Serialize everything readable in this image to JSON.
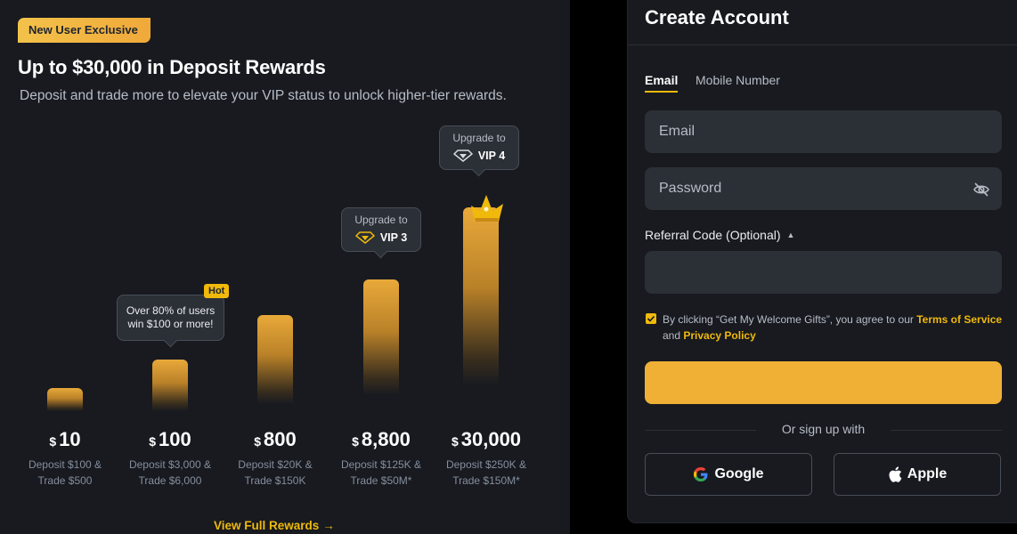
{
  "promo": {
    "badge": "New User Exclusive",
    "title": "Up to $30,000 in Deposit Rewards",
    "subtitle": "Deposit and trade more to elevate your VIP status to unlock higher-tier rewards.",
    "currency_symbol": "$",
    "tiers": [
      {
        "amount": "10",
        "desc_line1": "Deposit $100 &",
        "desc_line2": "Trade $500"
      },
      {
        "amount": "100",
        "desc_line1": "Deposit $3,000 &",
        "desc_line2": "Trade $6,000"
      },
      {
        "amount": "800",
        "desc_line1": "Deposit $20K &",
        "desc_line2": "Trade $150K"
      },
      {
        "amount": "8,800",
        "desc_line1": "Deposit $125K &",
        "desc_line2": "Trade $50M*"
      },
      {
        "amount": "30,000",
        "desc_line1": "Deposit $250K &",
        "desc_line2": "Trade $150M*"
      }
    ],
    "hot_tag": "Hot",
    "hot_tooltip_line1": "Over 80% of users",
    "hot_tooltip_line2": "win $100 or more!",
    "upgrade_label": "Upgrade to",
    "vip3_label": "VIP 3",
    "vip4_label": "VIP 4",
    "view_full": "View Full Rewards",
    "accent_color": "#F0B90B"
  },
  "signup": {
    "title": "Create Account",
    "tabs": [
      {
        "label": "Email",
        "active": true
      },
      {
        "label": "Mobile Number",
        "active": false
      }
    ],
    "email_placeholder": "Email",
    "password_placeholder": "Password",
    "referral_label": "Referral Code (Optional)",
    "referral_value": "",
    "agree_prefix": "By clicking “Get My Welcome Gifts”, you agree to our",
    "terms_link": "Terms of Service",
    "agree_and": "and",
    "privacy_link": "Privacy Policy",
    "agree_checked": true,
    "primary_button_label": "",
    "or_text": "Or sign up with",
    "google_label": "Google",
    "apple_label": "Apple",
    "icons": [
      "eye-off-icon",
      "caret-up-icon",
      "check-icon",
      "google-icon",
      "apple-icon",
      "arrow-right-icon",
      "diamond-icon",
      "crown-icon"
    ]
  }
}
